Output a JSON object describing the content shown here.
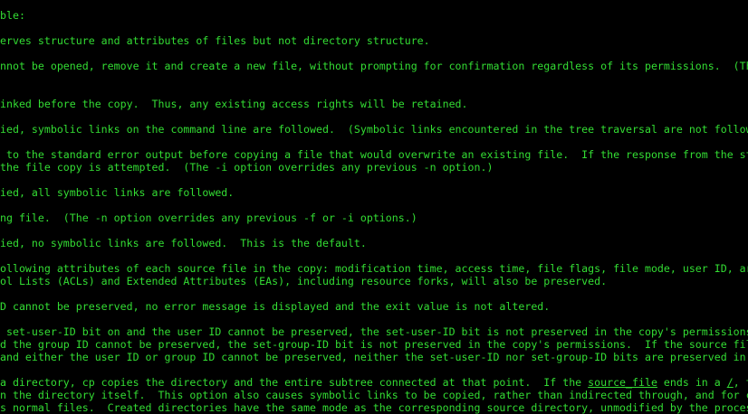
{
  "terminal": {
    "lines": [
      "ble:",
      "erves structure and attributes of files but not directory structure.",
      "nnot be opened, remove it and create a new file, without prompting for confirmation regardless of its permissions.  (Th",
      "inked before the copy.  Thus, any existing access rights will be retained.",
      "ied, symbolic links on the command line are followed.  (Symbolic links encountered in the tree traversal are not follow",
      " to the standard error output before copying a file that would overwrite an existing file.  If the response from the st",
      "the file copy is attempted.  (The -i option overrides any previous -n option.)",
      "ied, all symbolic links are followed.",
      "ng file.  (The -n option overrides any previous -f or -i options.)",
      "ied, no symbolic links are followed.  This is the default.",
      "ollowing attributes of each source file in the copy: modification time, access time, file flags, file mode, user ID, ar",
      "ol Lists (ACLs) and Extended Attributes (EAs), including resource forks, will also be preserved.",
      "D cannot be preserved, no error message is displayed and the exit value is not altered.",
      " set-user-ID bit on and the user ID cannot be preserved, the set-user-ID bit is not preserved in the copy's permissions",
      "d the group ID cannot be preserved, the set-group-ID bit is not preserved in the copy's permissions.  If the source fil",
      "and either the user ID or group ID cannot be preserved, neither the set-user-ID nor set-group-ID bits are preserved in",
      "a directory, cp copies the directory and the entire subtree connected at that point.  If the ",
      "source_file",
      " ends in a ",
      "/",
      ", t",
      "n the directory itself.  This option also causes symbolic links to be copied, rather than indirected through, and for c",
      "s normal files.  Created directories have the same mode as the corresponding source directory, unmodified by the proces"
    ]
  }
}
